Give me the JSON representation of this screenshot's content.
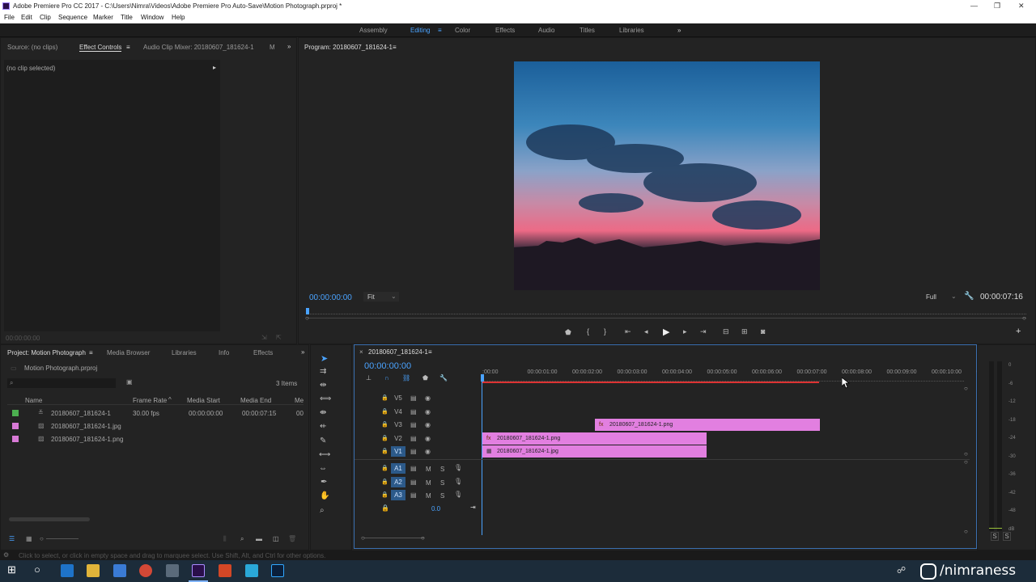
{
  "window": {
    "title": "Adobe Premiere Pro CC 2017 - C:\\Users\\Nimra\\Videos\\Adobe Premiere Pro Auto-Save\\Motion Photograph.prproj *"
  },
  "menu": [
    "File",
    "Edit",
    "Clip",
    "Sequence",
    "Marker",
    "Title",
    "Window",
    "Help"
  ],
  "workspaces": {
    "items": [
      "Assembly",
      "Editing",
      "Color",
      "Effects",
      "Audio",
      "Titles",
      "Libraries"
    ],
    "active": "Editing"
  },
  "source_panel": {
    "tabs": [
      "Source: (no clips)",
      "Effect Controls",
      "Audio Clip Mixer: 20180607_181624-1",
      "M"
    ],
    "no_clip": "(no clip selected)",
    "timecode": "00:00:00:00"
  },
  "program": {
    "title": "Program: 20180607_181624-1",
    "timecode": "00:00:00:00",
    "fit": "Fit",
    "quality": "Full",
    "duration": "00:00:07:16"
  },
  "project": {
    "tabs": [
      "Project: Motion Photograph",
      "Media Browser",
      "Libraries",
      "Info",
      "Effects"
    ],
    "filename": "Motion Photograph.prproj",
    "items_count": "3 Items",
    "columns": [
      "Name",
      "Frame Rate",
      "Media Start",
      "Media End",
      "Me"
    ],
    "rows": [
      {
        "color": "#4caf50",
        "name": "20180607_181624-1",
        "fps": "30.00 fps",
        "start": "00:00:00:00",
        "end": "00:00:07:15",
        "more": "00"
      },
      {
        "color": "#d87ad6",
        "name": "20180607_181624-1.jpg",
        "fps": "",
        "start": "",
        "end": "",
        "more": ""
      },
      {
        "color": "#d87ad6",
        "name": "20180607_181624-1.png",
        "fps": "",
        "start": "",
        "end": "",
        "more": ""
      }
    ]
  },
  "timeline": {
    "title": "20180607_181624-1",
    "timecode": "00:00:00:00",
    "ruler": [
      ":00:00",
      "00:00:01:00",
      "00:00:02:00",
      "00:00:03:00",
      "00:00:04:00",
      "00:00:05:00",
      "00:00:06:00",
      "00:00:07:00",
      "00:00:08:00",
      "00:00:09:00",
      "00:00:10:00",
      "0"
    ],
    "video_tracks": [
      "V5",
      "V4",
      "V3",
      "V2",
      "V1"
    ],
    "audio_tracks": [
      "A1",
      "A2",
      "A3"
    ],
    "master_value": "0.0",
    "clips": {
      "v3": "20180607_181624-1.png",
      "v2": "20180607_181624-1.png",
      "v1": "20180607_181624-1.jpg"
    },
    "m_label": "M",
    "s_label": "S"
  },
  "meters": {
    "scale": [
      "0",
      "-6",
      "-12",
      "-18",
      "-24",
      "-30",
      "-36",
      "-42",
      "-48",
      "dB"
    ],
    "solo": [
      "S",
      "S"
    ]
  },
  "status": {
    "text": "Click to select, or click in empty space and drag to marquee select. Use Shift, Alt, and Ctrl for other options."
  },
  "taskbar": {
    "handle": "/nimraness"
  },
  "colors": {
    "accent": "#4aa3ff",
    "clip": "#e27fe0"
  }
}
